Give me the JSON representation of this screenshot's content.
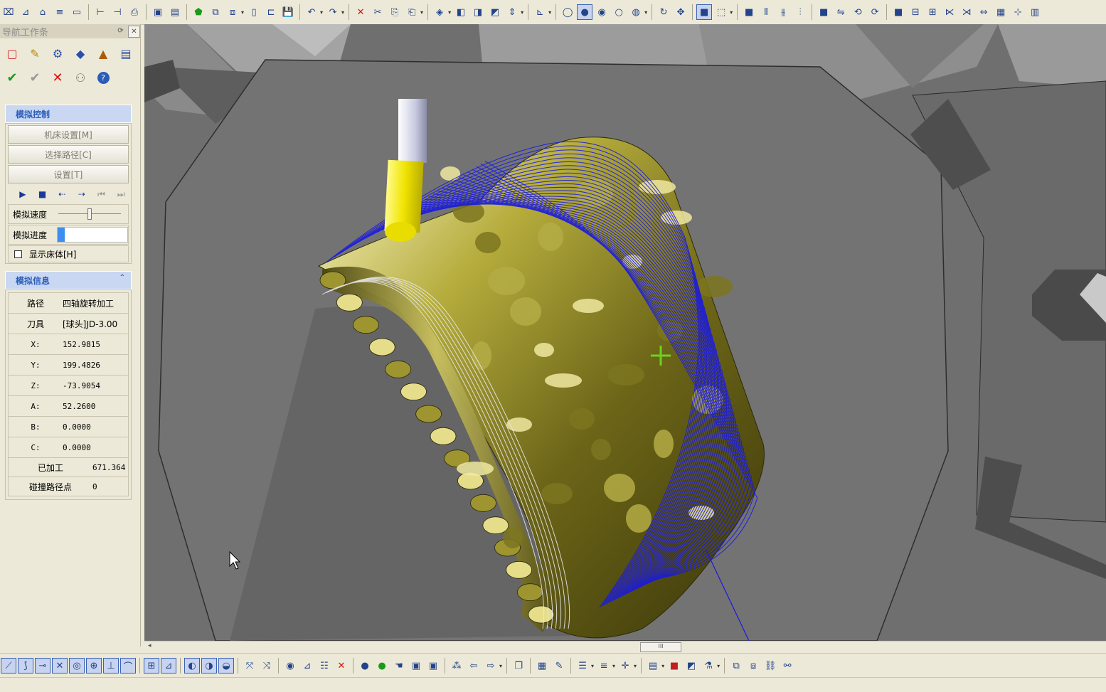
{
  "panel": {
    "title": "导航工作条",
    "sim_control": {
      "header": "模拟控制",
      "machine_setup": "机床设置[M]",
      "select_path": "选择路径[C]",
      "settings": "设置[T]",
      "speed_label": "模拟速度",
      "speed_value": 0.5,
      "progress_label": "模拟进度",
      "progress_value": 0.1,
      "show_bed_label": "显示床体[H]"
    },
    "sim_info": {
      "header": "模拟信息",
      "rows": [
        {
          "k": "路径",
          "v": "四轴旋转加工"
        },
        {
          "k": "刀具",
          "v": "[球头]JD-3.00"
        },
        {
          "k": "X:",
          "v": "152.9815"
        },
        {
          "k": "Y:",
          "v": "199.4826"
        },
        {
          "k": "Z:",
          "v": "-73.9054"
        },
        {
          "k": "A:",
          "v": "52.2600"
        },
        {
          "k": "B:",
          "v": "0.0000"
        },
        {
          "k": "C:",
          "v": "0.0000"
        },
        {
          "k": "已加工",
          "v": "671.364"
        },
        {
          "k": "碰撞路径点",
          "v": "0"
        }
      ]
    }
  },
  "scroll_thumb": "III",
  "colors": {
    "viewport_bg": "#6f6f6f",
    "part_gold": "#a39a32",
    "toolpath_blue": "#1a1ae0",
    "tool_yellow": "#f0e400",
    "header_blue": "#2b5db8"
  }
}
